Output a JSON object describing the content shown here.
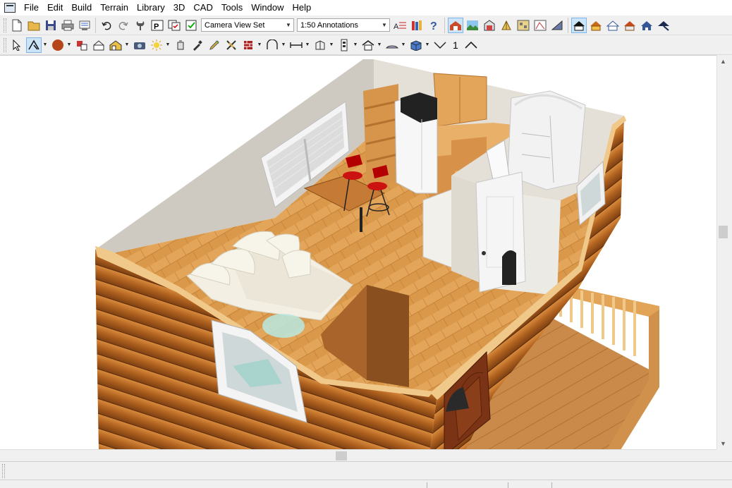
{
  "menu": {
    "items": [
      "File",
      "Edit",
      "Build",
      "Terrain",
      "Library",
      "3D",
      "CAD",
      "Tools",
      "Window",
      "Help"
    ]
  },
  "toolbar_top": {
    "camera_view_set": "Camera View Set",
    "annotation_set": "1:50 Annotations"
  },
  "toolbar_edit": {
    "number_label": "1"
  },
  "status": {
    "cell1": "",
    "cell2": "",
    "cell3": ""
  },
  "colors": {
    "toolbar_bg": "#f0f0f0",
    "active_button": "#cce4f7",
    "log_wall": "#b86a2a",
    "floor": "#d9984a",
    "interior_wall": "#d3cec4"
  },
  "icons": {
    "toolbar1": [
      "new-file-icon",
      "open-folder-icon",
      "save-icon",
      "print-icon",
      "print-preview-icon",
      "undo-icon",
      "redo-icon",
      "wrench-icon",
      "plan-view-icon",
      "layer-display-icon",
      "checklist-icon",
      "text-style-icon",
      "library-books-icon",
      "help-icon",
      "camera-icon",
      "terrain-view-icon",
      "cross-section-icon",
      "full-camera-icon",
      "plan-3d-icon",
      "elevation-icon",
      "perspective-icon",
      "roof-icon-1",
      "roof-icon-2",
      "roof-icon-3",
      "roof-icon-4",
      "roof-icon-5",
      "roof-icon-6"
    ],
    "toolbar2": [
      "select-arrow-icon",
      "edit-tool-icon",
      "color-circle-icon",
      "material-painter-icon",
      "symbol-icon",
      "camera-tool-icon",
      "light-icon",
      "paint-bucket-icon",
      "eyedropper-icon",
      "pencil-icon",
      "cross-icon",
      "wall-icon",
      "stair-icon",
      "dimension-icon",
      "cabinet-icon",
      "door-icon",
      "house-icon",
      "window-icon",
      "box-icon",
      "check-mark-icon",
      "caret-icon"
    ]
  }
}
